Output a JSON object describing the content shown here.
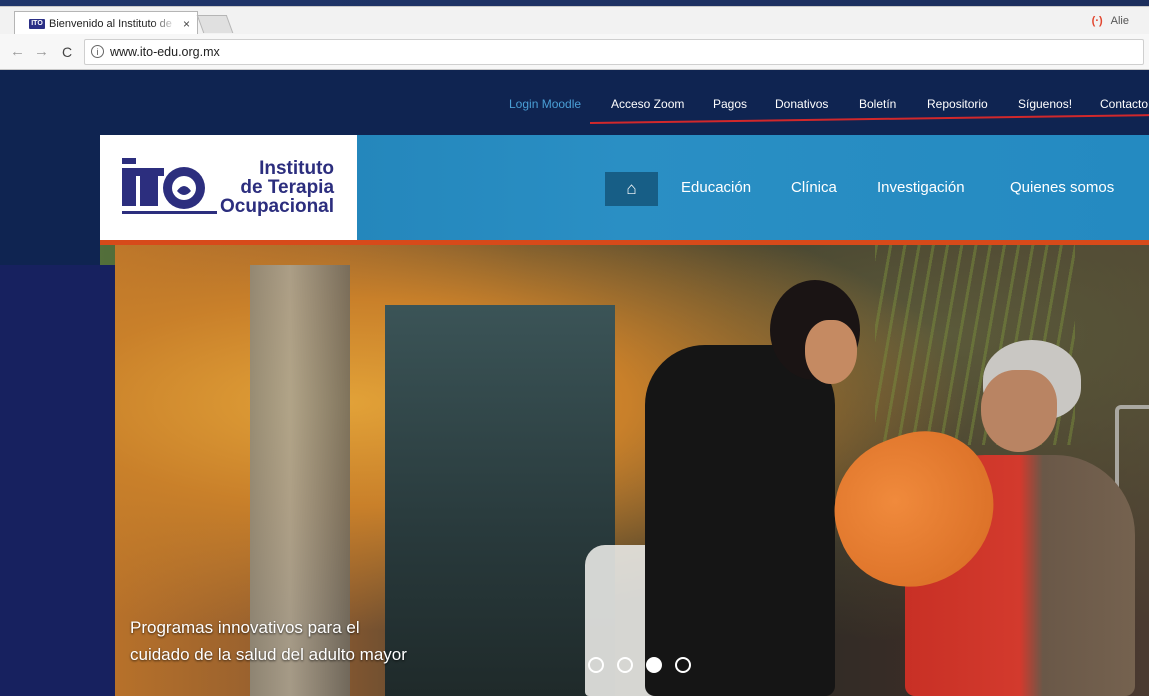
{
  "browser": {
    "tab_title": "Bienvenido al Instituto de",
    "tab_favicon": "ITO",
    "tab_close": "×",
    "user_label": "Alie",
    "url": "www.ito-edu.org.mx",
    "back_icon": "←",
    "forward_icon": "→",
    "reload_icon": "C",
    "info_icon": "i"
  },
  "site": {
    "top_nav": [
      "Login Moodle",
      "Acceso Zoom",
      "Pagos",
      "Donativos",
      "Boletín",
      "Repositorio",
      "Síguenos!",
      "Contacto"
    ],
    "logo": {
      "line1": "Instituto",
      "line2": "de Terapia",
      "line3": "Ocupacional"
    },
    "main_nav": {
      "home_icon": "⌂",
      "items": [
        "Educación",
        "Clínica",
        "Investigación",
        "Quienes somos"
      ]
    },
    "hero": {
      "caption_line1": "Programas innovativos para el",
      "caption_line2": "cuidado de la salud del adulto mayor",
      "slides": 4,
      "active_slide": 3
    }
  },
  "colors": {
    "header_blue": "#248ac1",
    "home_button": "#175e86",
    "accent_red": "#d74a1a",
    "logo_navy": "#2c2e7e",
    "active_link": "#4a9fd6"
  }
}
